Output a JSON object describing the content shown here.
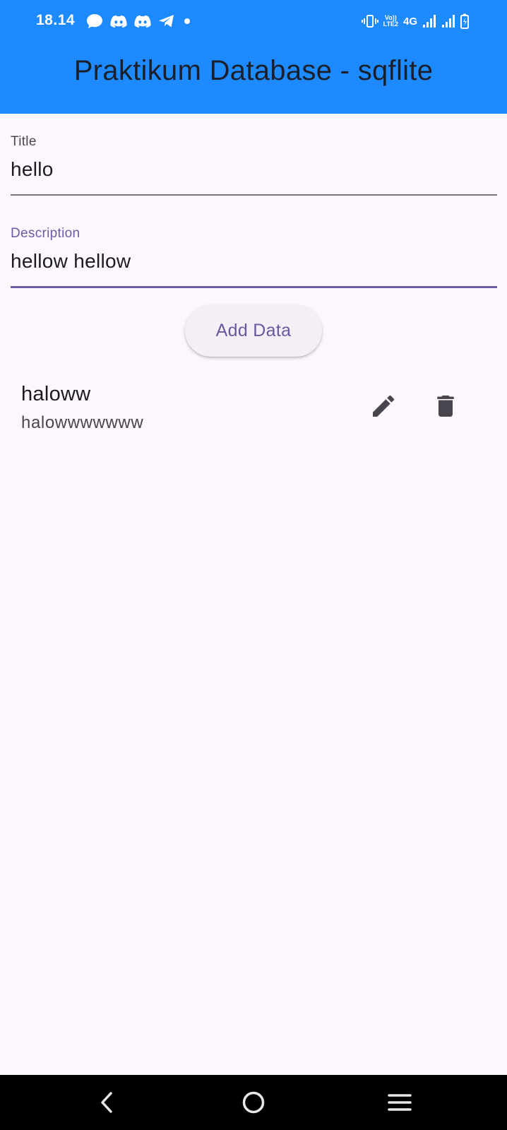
{
  "status_bar": {
    "time": "18.14",
    "network": "4G",
    "volte_top": "Vo))",
    "volte_bottom": "LTE2",
    "left_icons": [
      "chat-bubble-icon",
      "discord-icon",
      "discord-icon",
      "telegram-icon",
      "dot-icon"
    ],
    "right_icons": [
      "vibrate-icon",
      "volte-icon",
      "signal-icon",
      "signal-icon",
      "battery-charging-icon"
    ]
  },
  "app_bar": {
    "title": "Praktikum Database - sqflite",
    "color": "#1e8aff"
  },
  "form": {
    "title_label": "Title",
    "title_value": "hello",
    "description_label": "Description",
    "description_value": "hellow hellow"
  },
  "add_button_label": "Add Data",
  "items": [
    {
      "title": "haloww",
      "description": "halowwwwwww",
      "edit_icon": "pencil-icon",
      "delete_icon": "trash-icon"
    }
  ],
  "nav_bar": {
    "icons": [
      "back-icon",
      "home-icon",
      "recents-icon"
    ]
  },
  "colors": {
    "background": "#fcf6fd",
    "accent": "#6c5ba3",
    "icon": "#49454f"
  }
}
